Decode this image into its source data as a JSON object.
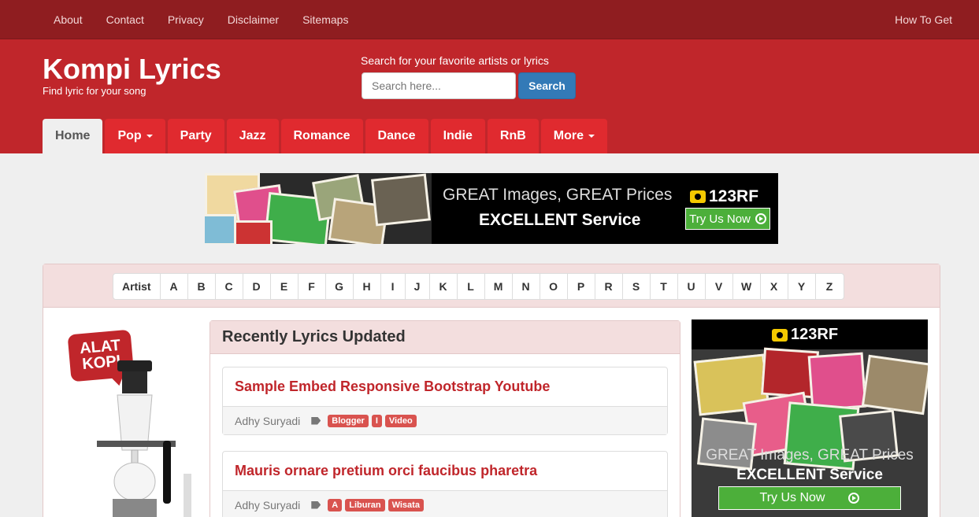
{
  "topnav": {
    "items": [
      "About",
      "Contact",
      "Privacy",
      "Disclaimer",
      "Sitemaps"
    ],
    "right_link": "How To Get"
  },
  "header": {
    "brand": "Kompi Lyrics",
    "tagline": "Find lyric for your song",
    "search_label": "Search for your favorite artists or lyrics",
    "search_placeholder": "Search here...",
    "search_button": "Search"
  },
  "menu": {
    "items": [
      {
        "label": "Home",
        "active": true,
        "dropdown": false
      },
      {
        "label": "Pop",
        "active": false,
        "dropdown": true
      },
      {
        "label": "Party",
        "active": false,
        "dropdown": false
      },
      {
        "label": "Jazz",
        "active": false,
        "dropdown": false
      },
      {
        "label": "Romance",
        "active": false,
        "dropdown": false
      },
      {
        "label": "Dance",
        "active": false,
        "dropdown": false
      },
      {
        "label": "Indie",
        "active": false,
        "dropdown": false
      },
      {
        "label": "RnB",
        "active": false,
        "dropdown": false
      },
      {
        "label": "More",
        "active": false,
        "dropdown": true
      }
    ]
  },
  "banner_ad": {
    "line1": "GREAT Images, GREAT Prices",
    "line2": "EXCELLENT Service",
    "brand": "123RF",
    "cta": "Try Us Now"
  },
  "alphabet": {
    "first": "Artist",
    "letters": [
      "A",
      "B",
      "C",
      "D",
      "E",
      "F",
      "G",
      "H",
      "I",
      "J",
      "K",
      "L",
      "M",
      "N",
      "O",
      "P",
      "R",
      "S",
      "T",
      "U",
      "V",
      "W",
      "X",
      "Y",
      "Z"
    ]
  },
  "side_ad": {
    "badge_line1": "ALAT",
    "badge_line2": "KOPI"
  },
  "recent": {
    "heading": "Recently Lyrics Updated",
    "posts": [
      {
        "title": "Sample Embed Responsive Bootstrap Youtube",
        "author": "Adhy Suryadi",
        "tags": [
          "Blogger",
          "I",
          "Video"
        ]
      },
      {
        "title": "Mauris ornare pretium orci faucibus pharetra",
        "author": "Adhy Suryadi",
        "tags": [
          "A",
          "Liburan",
          "Wisata"
        ]
      }
    ]
  },
  "right_ad": {
    "brand": "123RF",
    "line1": "GREAT Images, GREAT Prices",
    "line2": "EXCELLENT Service",
    "cta": "Try Us Now"
  },
  "colors": {
    "topbar": "#8f1d20",
    "header": "#c0262b",
    "menu_item": "#e02a2f",
    "link_red": "#c0262b",
    "search_blue": "#337ab7",
    "label_red": "#d9534f",
    "ad_green": "#4caf3a"
  }
}
